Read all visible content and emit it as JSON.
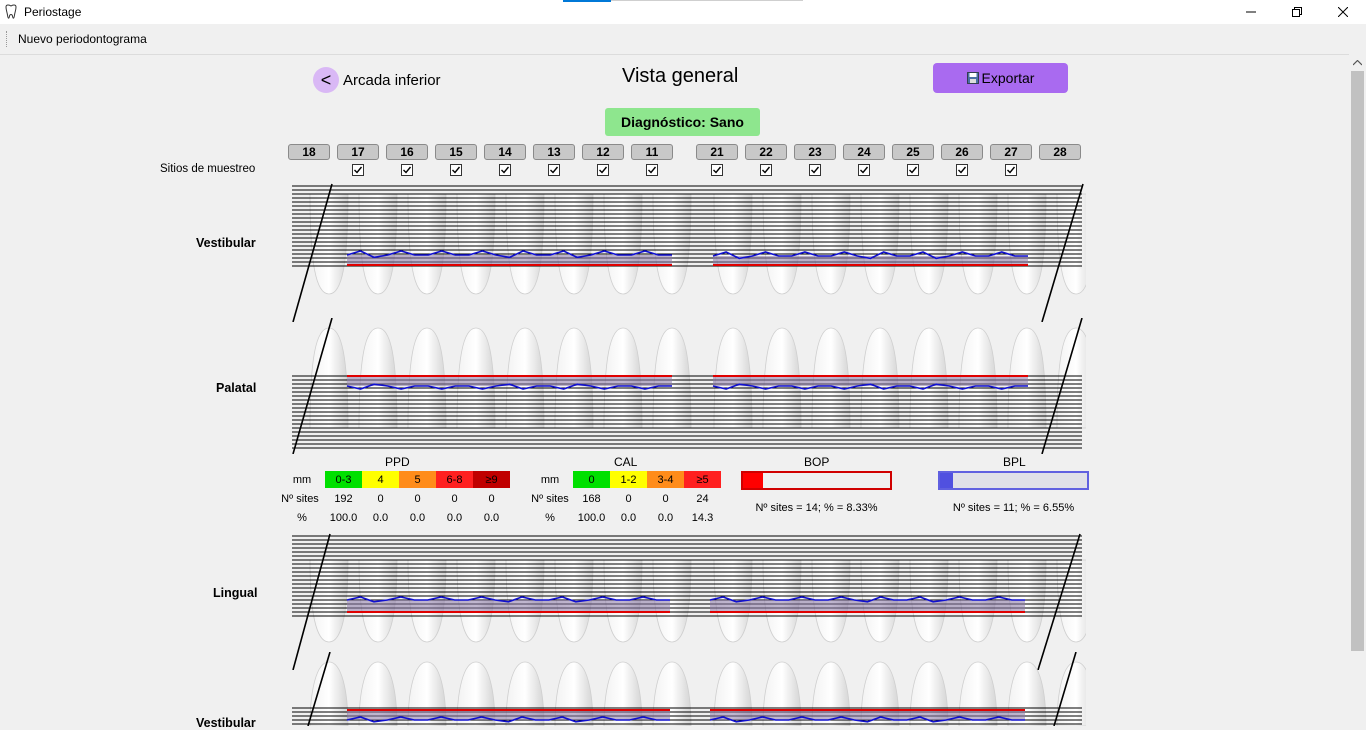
{
  "window": {
    "title": "Periostage"
  },
  "toolbar": {
    "new_label": "Nuevo periodontograma"
  },
  "header": {
    "back_label": "Arcada inferior",
    "page_title": "Vista general",
    "export_label": "Exportar"
  },
  "diagnosis": "Diagnóstico: Sano",
  "teeth_left": [
    "18",
    "17",
    "16",
    "15",
    "14",
    "13",
    "12",
    "11"
  ],
  "teeth_right": [
    "21",
    "22",
    "23",
    "24",
    "25",
    "26",
    "27",
    "28"
  ],
  "sites_label": "Sitios de muestreo",
  "sites_checked": {
    "left": [
      false,
      true,
      true,
      true,
      true,
      true,
      true,
      true
    ],
    "right": [
      true,
      true,
      true,
      true,
      true,
      true,
      true,
      false
    ]
  },
  "rows": {
    "vestibular": "Vestibular",
    "palatal": "Palatal",
    "lingual": "Lingual",
    "vestibular_lower": "Vestibular"
  },
  "ppd": {
    "title": "PPD",
    "unit": "mm",
    "ranges": [
      "0-3",
      "4",
      "5",
      "6-8",
      "≥9"
    ],
    "colors": [
      "#00e000",
      "#ffff00",
      "#ff8c1a",
      "#ff2020",
      "#c00000"
    ],
    "sites_label": "Nº sites",
    "pct_label": "%",
    "sites": [
      "192",
      "0",
      "0",
      "0",
      "0"
    ],
    "pct": [
      "100.0",
      "0.0",
      "0.0",
      "0.0",
      "0.0"
    ]
  },
  "cal": {
    "title": "CAL",
    "unit": "mm",
    "ranges": [
      "0",
      "1-2",
      "3-4",
      "≥5"
    ],
    "colors": [
      "#00e000",
      "#ffff00",
      "#ff8c1a",
      "#ff2020"
    ],
    "sites_label": "Nº sites",
    "pct_label": "%",
    "sites": [
      "168",
      "0",
      "0",
      "24"
    ],
    "pct": [
      "100.0",
      "0.0",
      "0.0",
      "14.3"
    ]
  },
  "bop": {
    "title": "BOP",
    "text": "Nº sites = 14; % = 8.33%",
    "fraction": 0.0833,
    "color": "#ff0000"
  },
  "bpl": {
    "title": "BPL",
    "text": "Nº sites = 11; % = 6.55%",
    "fraction": 0.0655,
    "color": "#5050e0"
  }
}
